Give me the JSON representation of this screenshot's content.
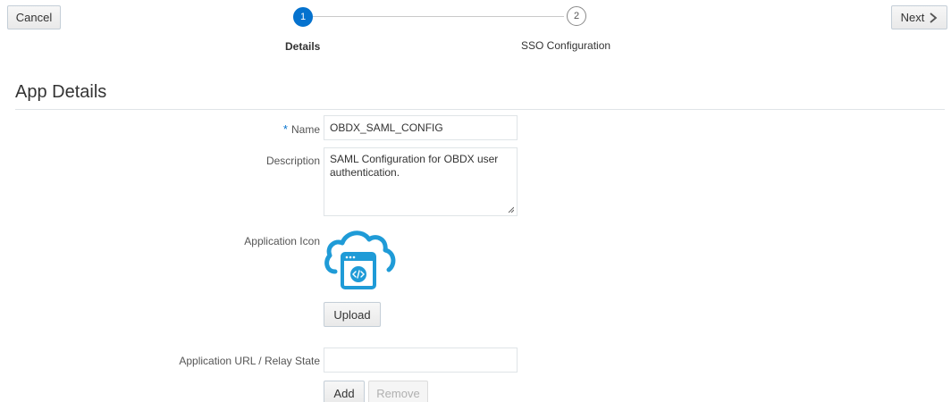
{
  "toolbar": {
    "cancel_label": "Cancel",
    "next_label": "Next"
  },
  "train": {
    "steps": [
      {
        "number": "1",
        "label": "Details",
        "state": "active"
      },
      {
        "number": "2",
        "label": "SSO Configuration",
        "state": "inactive"
      }
    ]
  },
  "page": {
    "title": "App Details"
  },
  "form": {
    "name": {
      "required_marker": "*",
      "label": "Name",
      "value": "OBDX_SAML_CONFIG"
    },
    "description": {
      "label": "Description",
      "value": "SAML Configuration for OBDX user authentication."
    },
    "application_icon": {
      "label": "Application Icon",
      "icon": "cloud-code-icon",
      "upload_label": "Upload"
    },
    "application_url": {
      "label": "Application URL / Relay State",
      "value": "",
      "add_label": "Add",
      "remove_label": "Remove"
    }
  },
  "colors": {
    "accent": "#0572ce",
    "icon_blue": "#1f9bd7",
    "border": "#dfe4e7"
  }
}
